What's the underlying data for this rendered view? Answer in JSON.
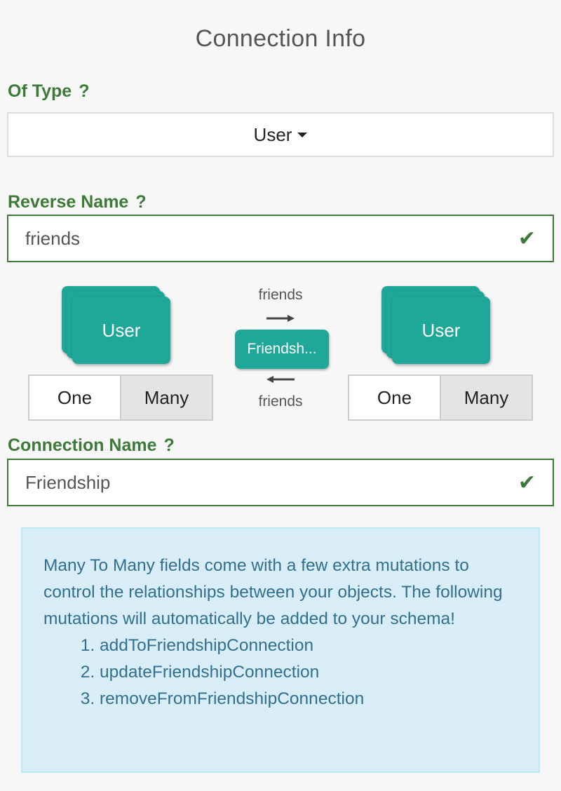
{
  "title": "Connection Info",
  "of_type": {
    "label": "Of Type",
    "help": "?",
    "value": "User"
  },
  "reverse_name": {
    "label": "Reverse Name",
    "help": "?",
    "value": "friends"
  },
  "diagram": {
    "left_type": "User",
    "right_type": "User",
    "connection_short": "Friendsh...",
    "forward_label": "friends",
    "backward_label": "friends",
    "left_cardinality": {
      "one": "One",
      "many": "Many",
      "selected": "Many"
    },
    "right_cardinality": {
      "one": "One",
      "many": "Many",
      "selected": "Many"
    }
  },
  "connection_name": {
    "label": "Connection Name",
    "help": "?",
    "value": "Friendship"
  },
  "info": {
    "text": "Many To Many fields come with a few extra mutations to control the relationships between your objects. The following mutations will automatically be added to your schema!",
    "mutations": [
      "addToFriendshipConnection",
      "updateFriendshipConnection",
      "removeFromFriendshipConnection"
    ]
  },
  "colors": {
    "accent_green": "#3d7a3a",
    "teal": "#1fa89a",
    "info_bg": "#d9edf7",
    "info_text": "#31708f"
  }
}
